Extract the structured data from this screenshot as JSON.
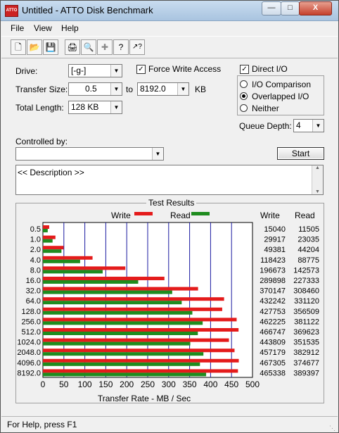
{
  "window": {
    "title": "Untitled - ATTO Disk Benchmark",
    "app_icon_text": "ATTO",
    "min_glyph": "—",
    "max_glyph": "□",
    "close_glyph": "X"
  },
  "menu": {
    "file": "File",
    "view": "View",
    "help": "Help"
  },
  "toolbar": {
    "icons": [
      "new-icon",
      "open-icon",
      "save-icon",
      "print-icon",
      "print-preview-icon",
      "move-icon",
      "help-icon",
      "context-help-icon"
    ],
    "glyphs": {
      "new": "🗋",
      "open": "📂",
      "save": "💾",
      "print": "🖨",
      "preview": "🔍",
      "move": "✚",
      "help": "?",
      "context_help": "↗?"
    }
  },
  "settings": {
    "drive_label": "Drive:",
    "drive_value": "[-g-]",
    "transfer_size_label": "Transfer Size:",
    "transfer_from": "0.5",
    "to_label": "to",
    "transfer_to": "8192.0",
    "kb_label": "KB",
    "total_length_label": "Total Length:",
    "total_length_value": "128 KB",
    "force_write_label": "Force Write Access",
    "force_write_checked": true,
    "direct_io_label": "Direct I/O",
    "direct_io_checked": true,
    "io_options": [
      "I/O Comparison",
      "Overlapped I/O",
      "Neither"
    ],
    "io_selected": "Overlapped I/O",
    "queue_depth_label": "Queue Depth:",
    "queue_depth_value": "4",
    "controlled_by_label": "Controlled by:",
    "controlled_by_value": "",
    "start_label": "Start",
    "description": "<< Description >>"
  },
  "results": {
    "title": "Test Results",
    "write_label": "Write",
    "read_label": "Read",
    "col_write": "Write",
    "col_read": "Read"
  },
  "chart_data": {
    "type": "bar",
    "orientation": "horizontal",
    "categories": [
      "0.5",
      "1.0",
      "2.0",
      "4.0",
      "8.0",
      "16.0",
      "32.0",
      "64.0",
      "128.0",
      "256.0",
      "512.0",
      "1024.0",
      "2048.0",
      "4096.0",
      "8192.0"
    ],
    "series": [
      {
        "name": "Write",
        "color": "#e41b1b",
        "values": [
          15040,
          29917,
          49381,
          118423,
          196673,
          289898,
          370147,
          432242,
          427753,
          462225,
          466747,
          443809,
          457179,
          467305,
          465338
        ]
      },
      {
        "name": "Read",
        "color": "#1e8c1e",
        "values": [
          11505,
          23035,
          44204,
          88775,
          142573,
          227333,
          308460,
          331120,
          356509,
          381122,
          369623,
          351535,
          382912,
          374677,
          389397
        ]
      }
    ],
    "value_units": "KB/s",
    "xlabel": "Transfer Rate - MB / Sec",
    "xlim": [
      0,
      500
    ],
    "xticks": [
      "0",
      "50",
      "100",
      "150",
      "200",
      "250",
      "300",
      "350",
      "400",
      "450",
      "500"
    ],
    "grid": true
  },
  "status": {
    "text": "For Help, press F1"
  }
}
